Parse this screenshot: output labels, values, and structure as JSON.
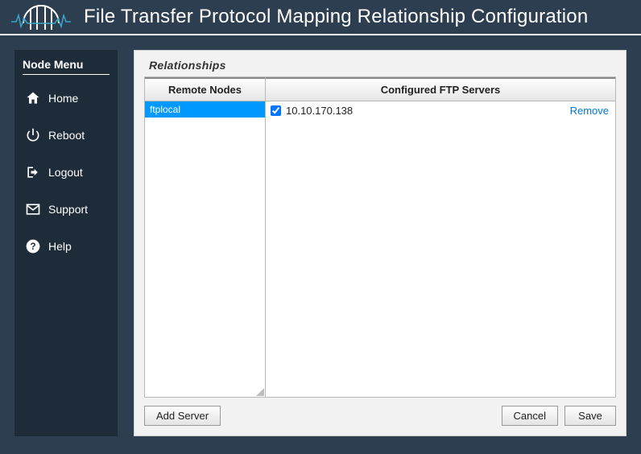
{
  "header": {
    "title": "File Transfer Protocol Mapping Relationship Configuration"
  },
  "sidebar": {
    "title": "Node Menu",
    "items": [
      {
        "label": "Home"
      },
      {
        "label": "Reboot"
      },
      {
        "label": "Logout"
      },
      {
        "label": "Support"
      },
      {
        "label": "Help"
      }
    ]
  },
  "panel": {
    "title": "Relationships",
    "remote_header": "Remote Nodes",
    "servers_header": "Configured FTP Servers",
    "remote_nodes": [
      {
        "name": "ftplocal",
        "selected": true
      }
    ],
    "servers": [
      {
        "ip": "10.10.170.138",
        "checked": true,
        "remove_label": "Remove"
      }
    ],
    "buttons": {
      "add_server": "Add Server",
      "cancel": "Cancel",
      "save": "Save"
    }
  }
}
